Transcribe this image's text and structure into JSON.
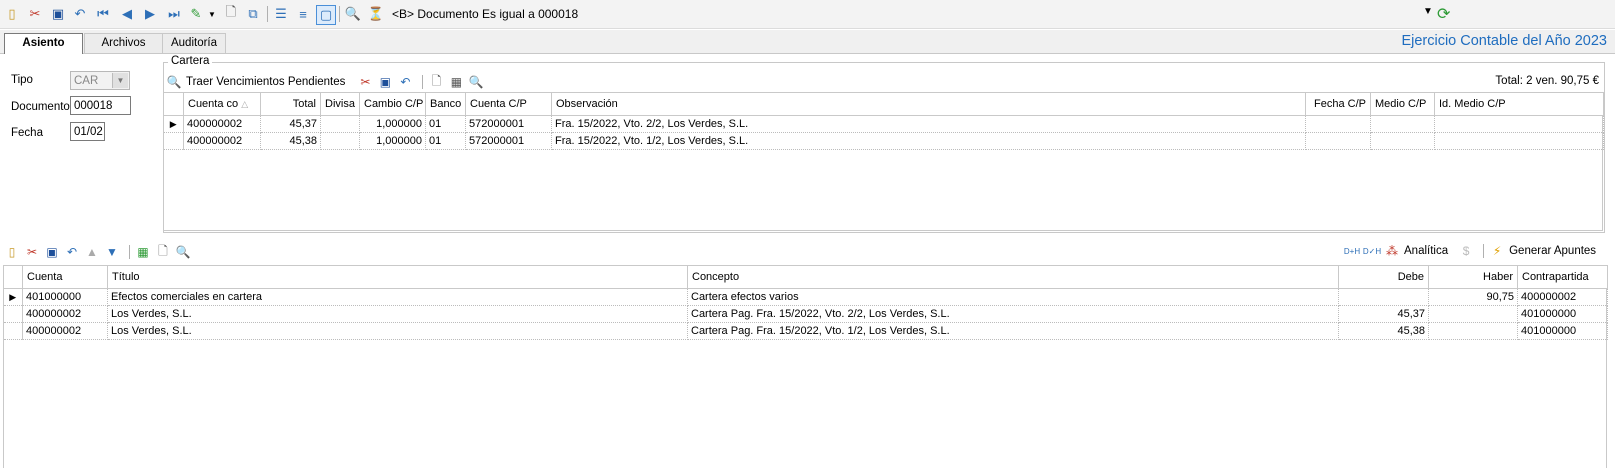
{
  "toolbar": {
    "filter_text": "<B> Documento Es igual a 000018"
  },
  "tabs": [
    {
      "label": "Asiento"
    },
    {
      "label": "Archivos"
    },
    {
      "label": "Auditoría"
    }
  ],
  "header": {
    "ejercicio": "Ejercicio Contable del Año 2023"
  },
  "form": {
    "tipo_label": "Tipo",
    "tipo_value": "CAR",
    "documento_label": "Documento",
    "documento_value": "000018",
    "fecha_label": "Fecha",
    "fecha_value": "01/02"
  },
  "cartera": {
    "legend": "Cartera",
    "traer_label": "Traer Vencimientos Pendientes",
    "total": "Total: 2 ven. 90,75 €",
    "columns": [
      "Cuenta co",
      "Total",
      "Divisa",
      "Cambio C/P",
      "Banco",
      "Cuenta C/P",
      "Observación",
      "Fecha C/P",
      "Medio C/P",
      "Id. Medio C/P"
    ],
    "rows": [
      {
        "cuenta": "400000002",
        "total": "45,37",
        "divisa": "",
        "cambio": "1,000000",
        "banco": "01",
        "cuenta_cp": "572000001",
        "observacion": "Fra. 15/2022, Vto. 2/2, Los Verdes, S.L.",
        "fecha_cp": "",
        "medio_cp": "",
        "id_medio": ""
      },
      {
        "cuenta": "400000002",
        "total": "45,38",
        "divisa": "",
        "cambio": "1,000000",
        "banco": "01",
        "cuenta_cp": "572000001",
        "observacion": "Fra. 15/2022, Vto. 1/2, Los Verdes, S.L.",
        "fecha_cp": "",
        "medio_cp": "",
        "id_medio": ""
      }
    ]
  },
  "apuntes": {
    "analitica_label": "Analítica",
    "generar_label": "Generar Apuntes",
    "columns": [
      "Cuenta",
      "Título",
      "Concepto",
      "Debe",
      "Haber",
      "Contrapartida"
    ],
    "rows": [
      {
        "cuenta": "401000000",
        "titulo": "Efectos comerciales en cartera",
        "concepto": "Cartera efectos varios",
        "debe": "",
        "haber": "90,75",
        "contrapartida": "400000002"
      },
      {
        "cuenta": "400000002",
        "titulo": "Los Verdes, S.L.",
        "concepto": "Cartera Pag. Fra. 15/2022, Vto. 2/2, Los Verdes, S.L.",
        "debe": "45,37",
        "haber": "",
        "contrapartida": "401000000"
      },
      {
        "cuenta": "400000002",
        "titulo": "Los Verdes, S.L.",
        "concepto": "Cartera Pag. Fra. 15/2022, Vto. 1/2, Los Verdes, S.L.",
        "debe": "45,38",
        "haber": "",
        "contrapartida": "401000000"
      }
    ]
  }
}
